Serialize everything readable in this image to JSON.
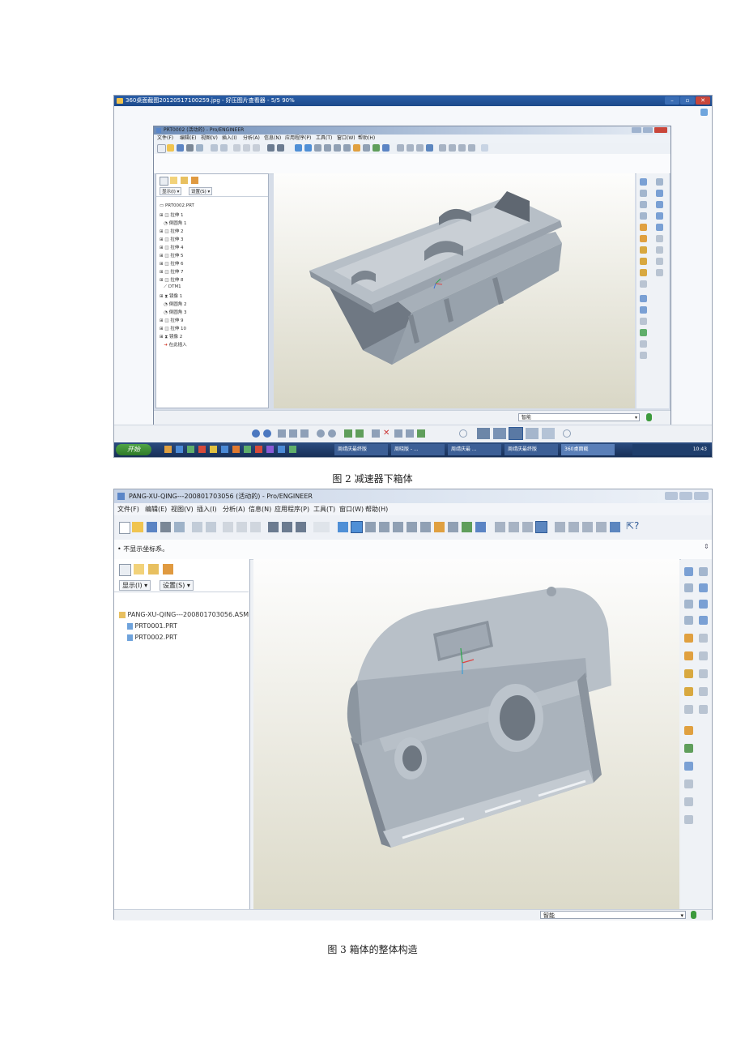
{
  "figure2": {
    "caption": "图 2  减速器下箱体",
    "viewer_title": "360桌面截图20120517100259.jpg - 好压图片查看器 - 5/5 90%",
    "proe_title": "PRT0002 (活动的) - Pro/ENGINEER",
    "menu": [
      "文件(F)",
      "编辑(E)",
      "视图(V)",
      "插入(I)",
      "分析(A)",
      "信息(N)",
      "应用程序(P)",
      "工具(T)",
      "窗口(W)",
      "帮助(H)"
    ],
    "tree_controls": [
      "显示(I) ▾",
      "设置(S) ▾"
    ],
    "model_tree": [
      "PRT0002.PRT",
      "拉伸 1",
      "倒圆角 1",
      "拉伸 2",
      "拉伸 3",
      "拉伸 4",
      "拉伸 5",
      "拉伸 6",
      "拉伸 7",
      "拉伸 8",
      "DTM1",
      "镜像 1",
      "倒圆角 2",
      "倒圆角 3",
      "拉伸 9",
      "拉伸 10",
      "镜像 2",
      "在此插入"
    ],
    "status_filter": "智能",
    "start_label": "开始",
    "taskbar_items": [
      "周靖庆最终版",
      "周晓版 - ...",
      "周靖庆最 ...",
      "周靖庆最终版",
      "360桌面截"
    ],
    "clock": "10:43"
  },
  "figure3": {
    "caption": "图 3  箱体的整体构造",
    "proe_title": "PANG-XU-QING---200801703056 (活动的) - Pro/ENGINEER",
    "menu": [
      "文件(F)",
      "编辑(E)",
      "视图(V)",
      "插入(I)",
      "分析(A)",
      "信息(N)",
      "应用程序(P)",
      "工具(T)",
      "窗口(W)",
      "帮助(H)"
    ],
    "message": "• 不显示坐标系。",
    "tree_controls": [
      "显示(I) ▾",
      "设置(S) ▾"
    ],
    "model_tree": [
      "PANG-XU-QING---200801703056.ASM",
      "PRT0001.PRT",
      "PRT0002.PRT"
    ],
    "status_filter": "智能"
  },
  "colors": {
    "model_gray": "#9aa4ae",
    "title_blue": "#1d4a8a",
    "start_green": "#3a8a2e"
  }
}
